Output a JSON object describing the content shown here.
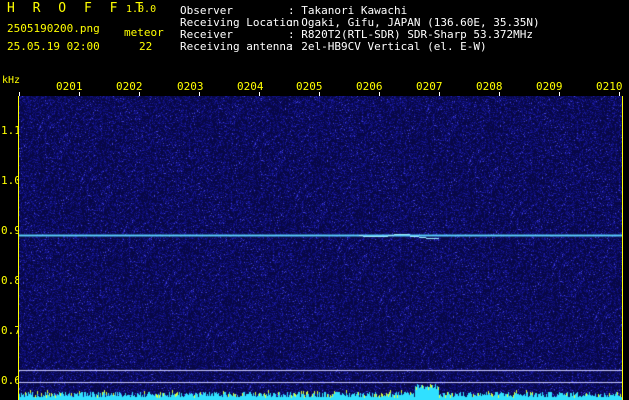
{
  "header": {
    "app_title": "H R O F F T",
    "version": "1.0.0",
    "filename": "2505190200.png",
    "datetime": "25.05.19 02:00",
    "meteor_label": "meteor",
    "meteor_count": "22"
  },
  "station": {
    "rows": [
      {
        "label": "Observer",
        "value": ": Takanori Kawachi"
      },
      {
        "label": "Receiving Location",
        "value": ": Ogaki, Gifu, JAPAN (136.60E, 35.35N)"
      },
      {
        "label": "Receiver",
        "value": ": R820T2(RTL-SDR) SDR-Sharp 53.372MHz"
      },
      {
        "label": "Receiving antenna",
        "value": ": 2el-HB9CV Vertical (el. E-W)"
      }
    ]
  },
  "spectrogram": {
    "freq_unit": "kHz",
    "time_ticks": [
      "0201",
      "0202",
      "0203",
      "0204",
      "0205",
      "0206",
      "0207",
      "0208",
      "0209",
      "0210"
    ],
    "freq_ticks": [
      "1.1",
      "1.0",
      "0.9",
      "0.8",
      "0.7",
      "0.6"
    ],
    "carrier_freq_khz": 0.89,
    "colors": {
      "background": "#0a0a3a",
      "noise_dark": "#10107a",
      "noise_light": "#3a3ad8",
      "carrier": "#5ad2ff",
      "baseline": "#30e0ff",
      "label_yellow": "#ffff00",
      "label_white": "#ffffff"
    }
  }
}
